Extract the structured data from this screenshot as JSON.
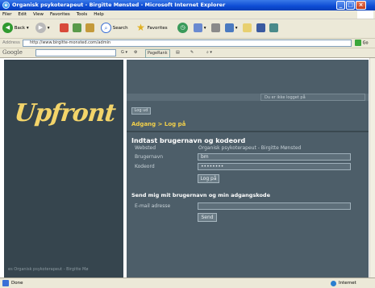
{
  "window": {
    "title": "Organisk psykoterapeut - Birgitte Mønsted - Microsoft Internet Explorer"
  },
  "menu": [
    "Filer",
    "Edit",
    "View",
    "Favorites",
    "Tools",
    "Help"
  ],
  "toolbar": {
    "back_label": "Back",
    "search_label": "Search",
    "favorites_label": "Favorites"
  },
  "address": {
    "label": "Address",
    "url": "http://www.birgitte-monsted.com/admin",
    "go_label": "Go"
  },
  "google": {
    "logo": "Google",
    "pagerank_label": "PageRank"
  },
  "page": {
    "logo": "Upfront",
    "logged_status": "Du er ikke logget på",
    "logout_label": "Log ud",
    "breadcrumb": "Adgang > Log på",
    "form_title": "Indtast brugernavn og kodeord",
    "site_label": "Websted",
    "site_value": "Organisk psykoterapeut - Birgitte Mønsted",
    "username_label": "Brugernavn",
    "username_value": "bm",
    "password_label": "Kodeord",
    "password_value": "••••••••",
    "login_button": "Log på",
    "send_title": "Send mig mit brugernavn og min adgangskode",
    "email_label": "E-mail adresse",
    "email_value": "",
    "send_button": "Send",
    "sidebar_footer": "es Organisk psykoterapeut - Birgitte Mø"
  },
  "status": {
    "text": "Done",
    "zone": "Internet"
  },
  "colors": {
    "sidebar": "#36454e",
    "main": "#4d5e69",
    "accent": "#f2d04a"
  }
}
